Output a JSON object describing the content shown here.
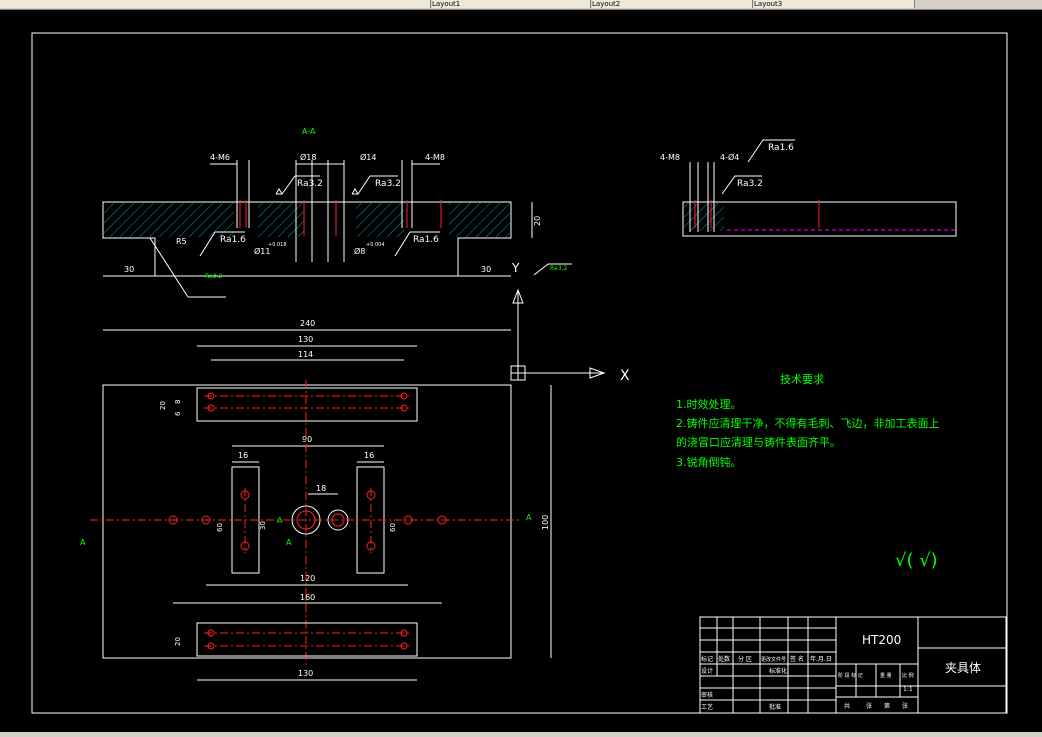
{
  "toolbar": {
    "tabs": [
      "Layout1",
      "Layout2",
      "Layout3"
    ]
  },
  "section_view": {
    "title": "A-A",
    "dims": {
      "m6_left": "4-M6",
      "d18": "Ø18",
      "d14": "Ø14",
      "m6_right": "4-M8",
      "d11": "Ø11",
      "d11_tol": "+0.018",
      "d8": "Ø8",
      "d8_tol": "+0.004",
      "r5": "R5",
      "w30_left": "30",
      "w30_right": "30",
      "h20": "20"
    },
    "rough": {
      "ra32_a": "Ra3.2",
      "ra32_b": "Ra3.2",
      "ra16_a": "Ra1.6",
      "ra16_b": "Ra1.6",
      "ra32_c": "Ra3.2",
      "ra32_d": "Ra3.2"
    }
  },
  "side_view": {
    "m8": "4-M8",
    "m4": "4-Ø4",
    "ra16": "Ra1.6",
    "ra32": "Ra3.2"
  },
  "plan_view": {
    "dims": {
      "w240": "240",
      "w130_top": "130",
      "w114": "114",
      "w90": "90",
      "w16_left": "16",
      "w16_right": "16",
      "w18": "18",
      "w120": "120",
      "w160": "160",
      "w130_bottom": "130",
      "h100": "100",
      "h20_top": "20",
      "h8": "8",
      "h6": "6",
      "h60_left": "60",
      "h30": "30",
      "h60_right": "60",
      "h20_bottom": "20",
      "sec_a_left": "A",
      "sec_a_right": "A",
      "sec_a_mid": "A",
      "sec_a_mid2": "A"
    },
    "axes": {
      "x": "X",
      "y": "Y"
    }
  },
  "notes": {
    "title": "技术要求",
    "lines": [
      "1.时效处理。",
      "2.铸件应清理干净，不得有毛刺、飞边，非加工表面上",
      "的浇冒口应清理与铸件表面齐平。",
      "3.锐角倒钝。"
    ],
    "rough_symbol": "√( √)"
  },
  "title_block": {
    "material": "HT200",
    "part_name": "夹具体",
    "scale": "1:1",
    "cells": {
      "biaoji": "标记",
      "chushu": "处数",
      "fenqu": "分 区",
      "gengai": "更改文件号",
      "qianming": "签 名",
      "date": "年.月.日",
      "sheji": "设计",
      "biaozhunhua": "标准化",
      "jieduan": "阶 段 标 记",
      "zhongliang": "重 量",
      "bili": "比 例",
      "shenhe": "审核",
      "gongyi": "工艺",
      "pizhun": "批准",
      "gong": "共",
      "zhang": "张",
      "di": "第",
      "zhang2": "张"
    }
  }
}
